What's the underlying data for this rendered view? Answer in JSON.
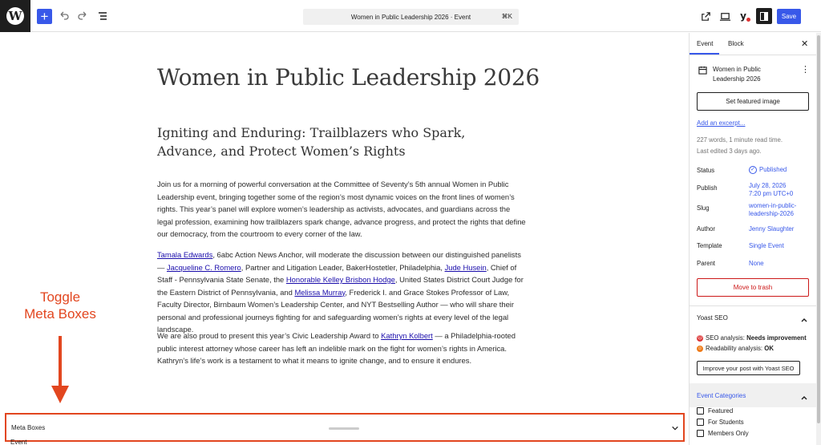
{
  "topbar": {
    "command_title": "Women in Public Leadership 2026 · Event",
    "shortcut": "⌘K",
    "save_label": "Save",
    "yoast_glyph": "y"
  },
  "content": {
    "title": "Women in Public Leadership 2026",
    "subtitle": "Igniting and Enduring: Trailblazers who Spark, Advance, and Protect Women’s Rights",
    "p1": "Join us for a morning of powerful conversation at the Committee of Seventy’s 5th annual Women in Public Leadership event, bringing together some of the region’s most dynamic voices on the front lines of women’s rights. This year’s panel will explore women’s leadership as activists, advocates, and guardians across the legal profession, examining how trailblazers spark change, advance progress, and protect the rights that define our democracy, from the courtroom to every corner of the law.",
    "p2": {
      "link1": "Tamala Edwards",
      "t1": ", 6abc Action News Anchor, will moderate the discussion between our distinguished panelists — ",
      "link2": "Jacqueline C. Romero",
      "t2": ", Partner and Litigation Leader, BakerHostetler, Philadelphia, ",
      "link3": "Jude Husein",
      "t3": ", Chief of Staff - Pennsylvania State Senate, the ",
      "link4": "Honorable Kelley Brisbon Hodge",
      "t4": ", United States District Court Judge for the Eastern District of Pennsylvania, and ",
      "link5": "Melissa Murray",
      "t5": ", Frederick I. and Grace Stokes Professor of Law, Faculty Director, Birnbaum Women’s Leadership Center, and NYT Bestselling Author — who will share their personal and professional journeys fighting for and safeguarding women’s rights at every level of the legal landscape."
    },
    "p3": {
      "t1": "We are also proud to present this year’s Civic Leadership Award to ",
      "link1": "Kathryn Kolbert",
      "t2": " — a Philadelphia-rooted public interest attorney whose career has left an indelible mark on the fight for women’s rights in America. Kathryn’s life’s work is a testament to what it means to ignite change, and to ensure it endures."
    }
  },
  "annotation": {
    "line1": "Toggle",
    "line2": "Meta Boxes",
    "color": "#e2461f"
  },
  "meta_boxes": {
    "label": "Meta Boxes",
    "peek": "Event"
  },
  "sidebar": {
    "tabs": [
      "Event",
      "Block"
    ],
    "post_title": "Women in Public Leadership 2026",
    "featured_image": "Set featured image",
    "excerpt": "Add an excerpt...",
    "stats": {
      "words": "227 words, 1 minute read time.",
      "edited": "Last edited 3 days ago."
    },
    "fields": {
      "status_label": "Status",
      "status_value": "Published",
      "publish_label": "Publish",
      "publish_line1": "July 28, 2026",
      "publish_line2": "7:20 pm UTC+0",
      "slug_label": "Slug",
      "slug_line1": "women-in-public-",
      "slug_line2": "leadership-2026",
      "author_label": "Author",
      "author_value": "Jenny Slaughter",
      "template_label": "Template",
      "template_value": "Single Event",
      "parent_label": "Parent",
      "parent_value": "None"
    },
    "trash": "Move to trash",
    "yoast": {
      "title": "Yoast SEO",
      "seo_prefix": "SEO analysis: ",
      "seo_value": "Needs improvement",
      "read_prefix": "Readability analysis: ",
      "read_value": "OK",
      "button": "Improve your post with Yoast SEO"
    },
    "categories": {
      "title": "Event Categories",
      "items": [
        "Featured",
        "For Students",
        "Members Only"
      ]
    }
  },
  "colors": {
    "accent": "#3858e9",
    "danger": "#cc1818"
  }
}
